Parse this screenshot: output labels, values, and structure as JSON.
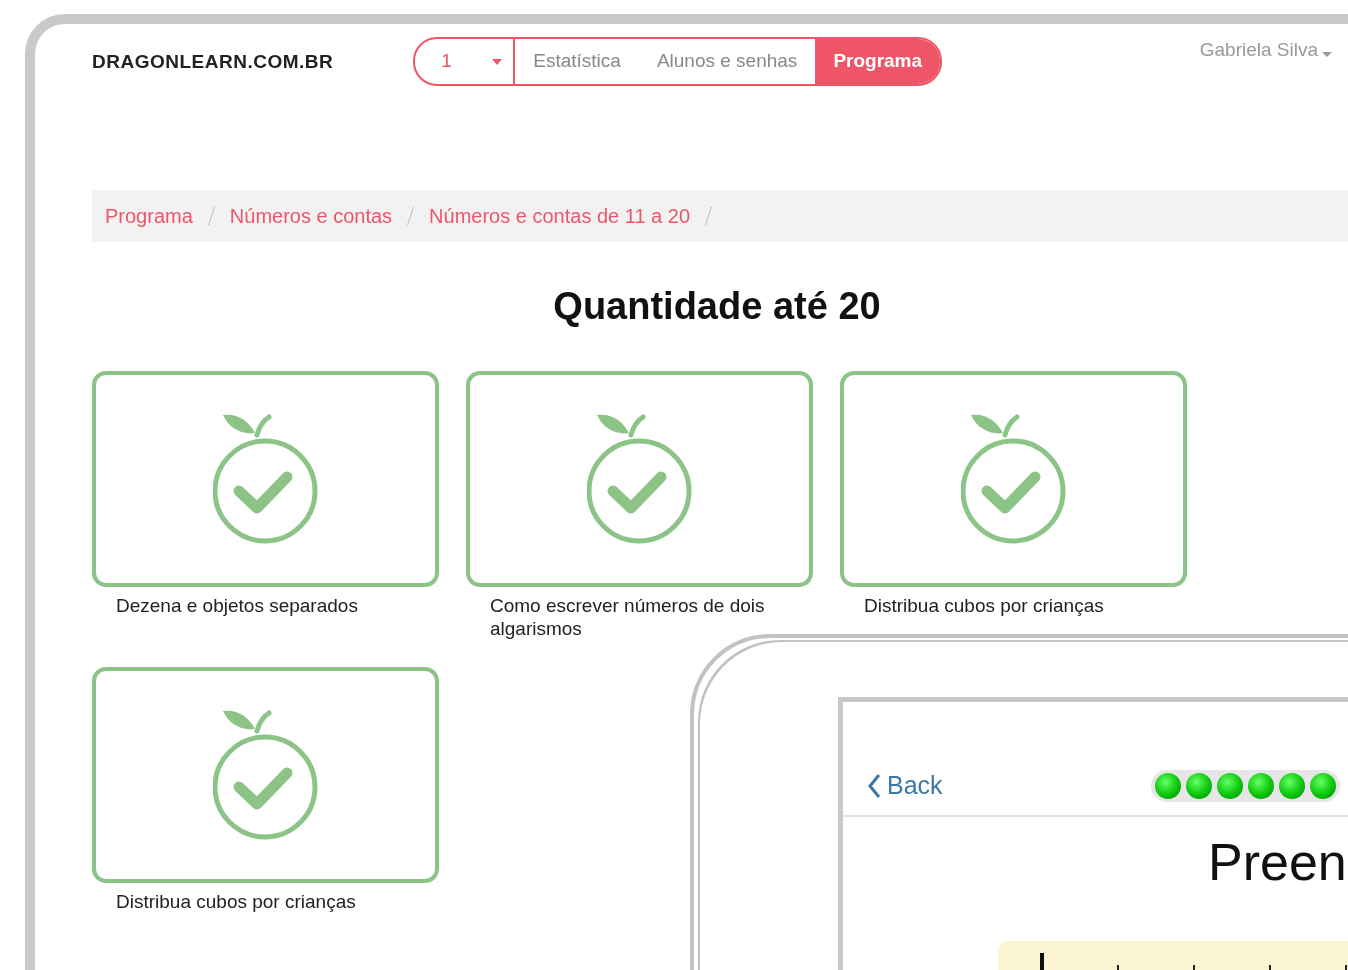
{
  "header": {
    "logo": "DRAGONLEARN.COM.BR",
    "grade_select": {
      "value": "1"
    },
    "tabs": [
      {
        "label": "Estatística",
        "selected": false
      },
      {
        "label": "Alunos e senhas",
        "selected": false
      },
      {
        "label": "Programa",
        "selected": true
      }
    ],
    "user_menu": "Gabriela Silva"
  },
  "breadcrumb": [
    "Programa",
    "Números e contas",
    "Números e contas de 11 a 20"
  ],
  "title": "Quantidade até 20",
  "lessons": [
    {
      "title": "Dezena e objetos separados",
      "completed": true
    },
    {
      "title": "Como escrever números de dois algarismos",
      "completed": true
    },
    {
      "title": "Distribua cubos por crianças",
      "completed": true
    },
    {
      "title": "Distribua cubos por crianças",
      "completed": true
    }
  ],
  "exercise": {
    "back": "Back",
    "progress": [
      {
        "done": true
      },
      {
        "done": true
      },
      {
        "done": true
      },
      {
        "done": true
      },
      {
        "done": true
      },
      {
        "done": true
      }
    ],
    "heading": "Preen"
  }
}
